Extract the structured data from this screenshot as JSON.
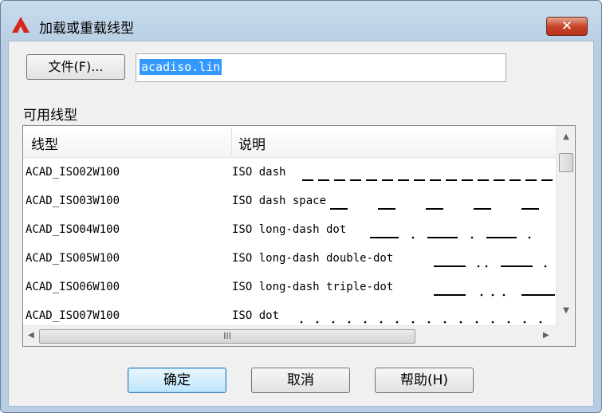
{
  "window": {
    "title": "加载或重载线型",
    "close_glyph": "✕",
    "accent": "#c7442a"
  },
  "file": {
    "button_label": "文件(F)...",
    "value": "acadiso.lin"
  },
  "list": {
    "section_label": "可用线型",
    "columns": [
      "线型",
      "说明"
    ],
    "rows": [
      {
        "name": "ACAD_ISO02W100",
        "desc": "ISO dash"
      },
      {
        "name": "ACAD_ISO03W100",
        "desc": "ISO dash space"
      },
      {
        "name": "ACAD_ISO04W100",
        "desc": "ISO long-dash dot"
      },
      {
        "name": "ACAD_ISO05W100",
        "desc": "ISO long-dash double-dot"
      },
      {
        "name": "ACAD_ISO06W100",
        "desc": "ISO long-dash triple-dot"
      },
      {
        "name": "ACAD_ISO07W100",
        "desc": "ISO dot"
      }
    ],
    "hscroll_grip": "III"
  },
  "buttons": {
    "ok": "确定",
    "cancel": "取消",
    "help": "帮助(H)"
  }
}
